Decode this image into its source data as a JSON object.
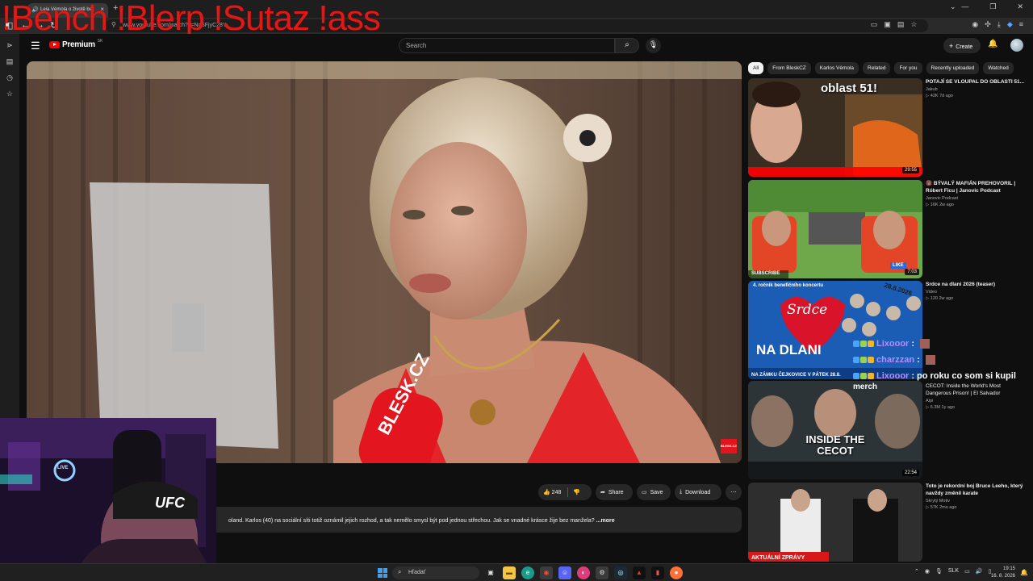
{
  "browser": {
    "tab_title": "Leia Vémola o životě bez",
    "url": "www.youtube.com/watch?v=NcSFjyC28Y",
    "overlay_commands": "!Bench !Blerp !Sutaz !ass"
  },
  "youtube": {
    "logo_text": "Premium",
    "region": "SK",
    "search_placeholder": "Search",
    "create_label": "Create"
  },
  "video": {
    "likes": "248",
    "share_label": "Share",
    "save_label": "Save",
    "download_label": "Download",
    "description": "oland. Karlos (40) na sociální síti totiž oznámil jejich rozhod, a tak nemělo smysl být pod jednou střechou. Jak se vnadné krásce žije bez manžela?",
    "more_label": "...more",
    "mic_badge": "BLESK.CZ",
    "corner_logo": "BLESK.CZ"
  },
  "chips": [
    "All",
    "From BleskCZ",
    "Karlos Vémola",
    "Related",
    "For you",
    "Recently uploaded",
    "Watched"
  ],
  "recommendations": [
    {
      "title": "POTAJÍ SE VLOUPAL DO OBLASTI 51...",
      "channel": "Jakub",
      "meta": "▷ 42K  7d ago",
      "duration": "29:55",
      "thumb_text": "oblast 51!"
    },
    {
      "title": "🔞 BÝVALÝ MAFIÁN PREHOVORIL | Róbert Ficu | Janovic Podcast",
      "channel": "Janovic Podcast",
      "meta": "▷ 16K  2w ago",
      "duration": "7:03",
      "thumb_text": "SUBSCRIBE"
    },
    {
      "title": "Srdce na dlani 2026 (teaser)",
      "channel": "Video",
      "meta": "▷ 120  2w ago",
      "duration": "",
      "thumb_text": "NA DLANI"
    },
    {
      "title": "CECOT: Inside the World's Most Dangerous Prison! | El Salvador",
      "channel": "Alpi",
      "meta": "▷ 6.3M  1y ago",
      "duration": "22:54",
      "thumb_text": "INSIDE THE CECOT"
    },
    {
      "title": "Toto je rekordní boj Bruce Leeho, který navždy změnil karate",
      "channel": "Skrytý Motiv",
      "meta": "▷ 57K  2mo ago",
      "duration": "",
      "thumb_text": "AKTUÁLNÍ ZPRÁVY"
    }
  ],
  "thumb_extra": {
    "srdce_line1": "4. ročník benefičního koncertu",
    "srdce_line2": "Srdce",
    "srdce_line3": "NA ZÁMKU ČEJKOVICE V PÁTEK 28.8.",
    "date_badge": "28.8.2026",
    "like_badge": "LIKE"
  },
  "chat": [
    {
      "name": "Lixooor",
      "message": ""
    },
    {
      "name": "charzzan",
      "message": ""
    },
    {
      "name": "Lixooor",
      "message": "po roku co som si kupil"
    }
  ],
  "chat_continuation": "merch",
  "webcam": {
    "cap_text": "UFC",
    "live_sign": "LIVE"
  },
  "taskbar": {
    "search_placeholder": "Hľadať",
    "language": "SLK",
    "time": "19:15",
    "date": "16. 8. 2026"
  },
  "colors": {
    "accent": "#ff0000",
    "chat_name": "#b78cff",
    "overlay": "#e01818"
  }
}
